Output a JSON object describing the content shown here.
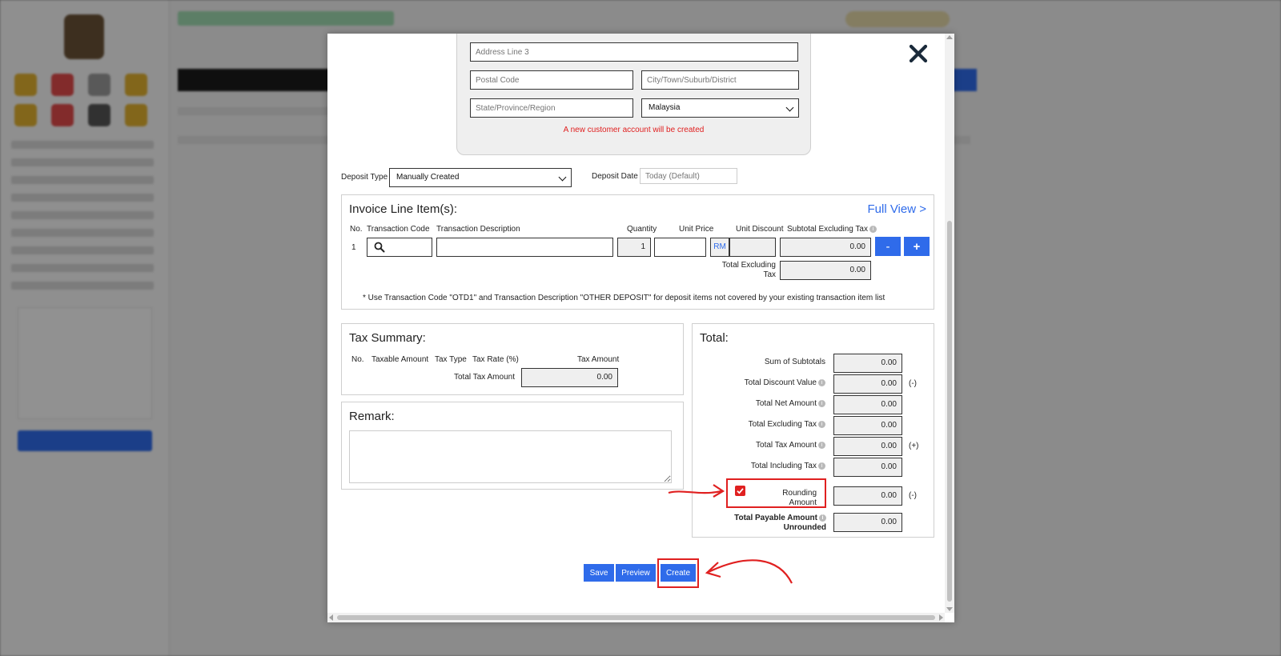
{
  "address": {
    "line3_placeholder": "Address Line 3",
    "postal_placeholder": "Postal Code",
    "city_placeholder": "City/Town/Suburb/District",
    "state_placeholder": "State/Province/Region",
    "country_value": "Malaysia",
    "new_account_note": "A new customer account will be created"
  },
  "deposit": {
    "type_label": "Deposit Type",
    "type_value": "Manually Created",
    "date_label": "Deposit Date",
    "date_placeholder": "Today (Default)"
  },
  "line_items": {
    "title": "Invoice Line Item(s):",
    "full_view": "Full View >",
    "columns": [
      "No.",
      "Transaction Code",
      "Transaction Description",
      "Quantity",
      "Unit Price",
      "Unit Discount",
      "Subtotal Excluding Tax"
    ],
    "rows": [
      {
        "no": "1",
        "code": "",
        "description": "",
        "quantity": "1",
        "unit_price": "",
        "currency": "RM",
        "discount": "",
        "subtotal": "0.00"
      }
    ],
    "remove_label": "-",
    "add_label": "+",
    "total_excluding_label": "Total Excluding Tax",
    "total_excluding_value": "0.00",
    "note": "* Use Transaction Code \"OTD1\" and Transaction Description \"OTHER DEPOSIT\" for deposit items not covered by your existing transaction item list"
  },
  "tax_summary": {
    "title": "Tax Summary:",
    "columns": [
      "No.",
      "Taxable Amount",
      "Tax Type",
      "Tax Rate (%)",
      "Tax Amount"
    ],
    "total_label": "Total Tax Amount",
    "total_value": "0.00"
  },
  "remark": {
    "title": "Remark:",
    "value": ""
  },
  "totals": {
    "title": "Total:",
    "sum_subtotals": {
      "label": "Sum of Subtotals",
      "value": "0.00"
    },
    "total_discount": {
      "label": "Total Discount Value",
      "value": "0.00",
      "sign": "(-)"
    },
    "total_net": {
      "label": "Total Net Amount",
      "value": "0.00"
    },
    "total_excl": {
      "label": "Total Excluding Tax",
      "value": "0.00"
    },
    "total_tax": {
      "label": "Total Tax Amount",
      "value": "0.00",
      "sign": "(+)"
    },
    "total_incl": {
      "label": "Total Including Tax",
      "value": "0.00"
    },
    "rounding": {
      "label_line1": "Rounding",
      "label_line2": "Amount",
      "value": "0.00",
      "sign": "(-)",
      "checked": true
    },
    "payable_unrounded": {
      "label_line1": "Total Payable Amount",
      "label_line2": "Unrounded",
      "value": "0.00"
    }
  },
  "actions": {
    "save": "Save",
    "preview": "Preview",
    "create": "Create"
  },
  "colors": {
    "accent": "#2f6bea",
    "highlight": "#e02020"
  },
  "icons": {
    "close": "close-icon",
    "search": "search-icon",
    "info": "info-icon"
  }
}
